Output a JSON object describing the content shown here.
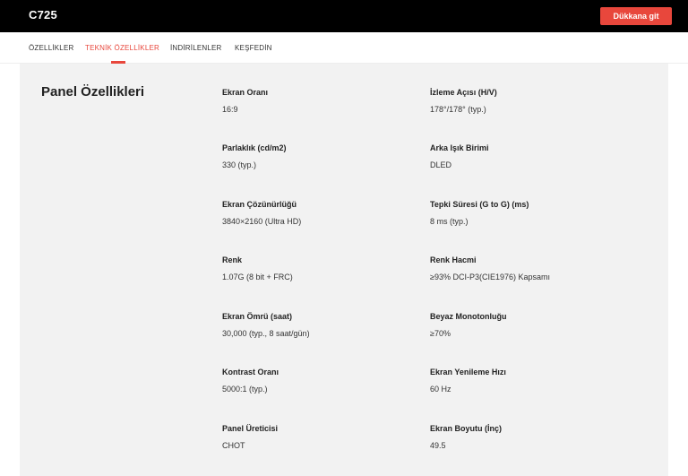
{
  "header": {
    "title": "C725",
    "shop_button": "Dükkana git"
  },
  "tabs": [
    {
      "label": "ÖZELLİKLER",
      "active": false
    },
    {
      "label": "TEKNİK ÖZELLİKLER",
      "active": true
    },
    {
      "label": "İNDİRİLENLER",
      "active": false
    },
    {
      "label": "KEŞFEDİN",
      "active": false
    }
  ],
  "colors": {
    "accent": "#e8473c",
    "topbar": "#000000",
    "panel_bg": "#f2f2f2"
  },
  "section": {
    "title": "Panel Özellikleri",
    "specs": [
      {
        "label": "Ekran Oranı",
        "value": "16:9"
      },
      {
        "label": "İzleme Açısı (H/V)",
        "value": "178°/178° (typ.)"
      },
      {
        "label": "Parlaklık (cd/m2)",
        "value": "330 (typ.)"
      },
      {
        "label": "Arka Işık Birimi",
        "value": "DLED"
      },
      {
        "label": "Ekran Çözünürlüğü",
        "value": "3840×2160 (Ultra HD)"
      },
      {
        "label": "Tepki Süresi (G to G) (ms)",
        "value": "8 ms (typ.)"
      },
      {
        "label": "Renk",
        "value": "1.07G (8 bit + FRC)"
      },
      {
        "label": "Renk Hacmi",
        "value": "≥93% DCI-P3(CIE1976) Kapsamı"
      },
      {
        "label": "Ekran Ömrü (saat)",
        "value": "30,000 (typ., 8 saat/gün)"
      },
      {
        "label": "Beyaz Monotonluğu",
        "value": "≥70%"
      },
      {
        "label": "Kontrast Oranı",
        "value": "5000:1 (typ.)"
      },
      {
        "label": "Ekran Yenileme Hızı",
        "value": "60 Hz"
      },
      {
        "label": "Panel Üreticisi",
        "value": "CHOT"
      },
      {
        "label": "Ekran Boyutu (İnç)",
        "value": "49.5"
      }
    ]
  }
}
